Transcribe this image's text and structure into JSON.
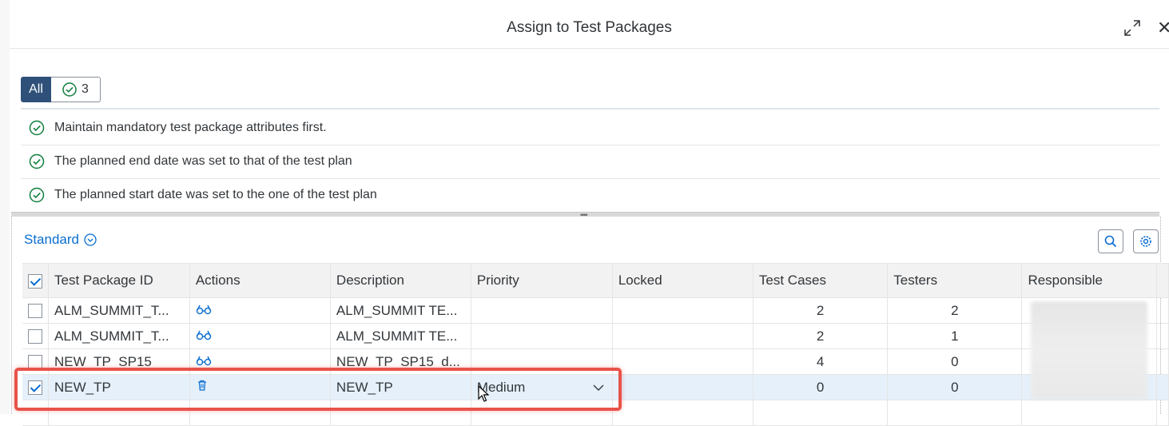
{
  "dialog": {
    "title": "Assign to Test Packages"
  },
  "filter": {
    "all_label": "All",
    "success_count": "3"
  },
  "messages": [
    "Maintain mandatory test package attributes first.",
    "The planned end date was set to that of the test plan",
    "The planned start date was set to the one of the test plan"
  ],
  "table": {
    "variant": "Standard",
    "columns": [
      "Test Package ID",
      "Actions",
      "Description",
      "Priority",
      "Locked",
      "Test Cases",
      "Testers",
      "Responsible"
    ],
    "rows": [
      {
        "id": "ALM_SUMMIT_T...",
        "action": "glasses-icon",
        "description": "ALM_SUMMIT TE...",
        "priority": "",
        "locked": "",
        "test_cases": "2",
        "testers": "2"
      },
      {
        "id": "ALM_SUMMIT_T...",
        "action": "glasses-icon",
        "description": "ALM_SUMMIT TE...",
        "priority": "",
        "locked": "",
        "test_cases": "2",
        "testers": "1"
      },
      {
        "id": "NEW_TP_SP15",
        "action": "glasses-icon",
        "description": "NEW_TP_SP15_d...",
        "priority": "",
        "locked": "",
        "test_cases": "4",
        "testers": "0"
      },
      {
        "id": "NEW_TP",
        "action": "trash-icon",
        "description": "NEW_TP",
        "priority": "Medium",
        "locked": "",
        "test_cases": "0",
        "testers": "0"
      }
    ]
  },
  "colors": {
    "accent": "#0a6ed1",
    "segment_active": "#2f5179",
    "success": "#107e3e",
    "highlight": "#e8534a"
  }
}
